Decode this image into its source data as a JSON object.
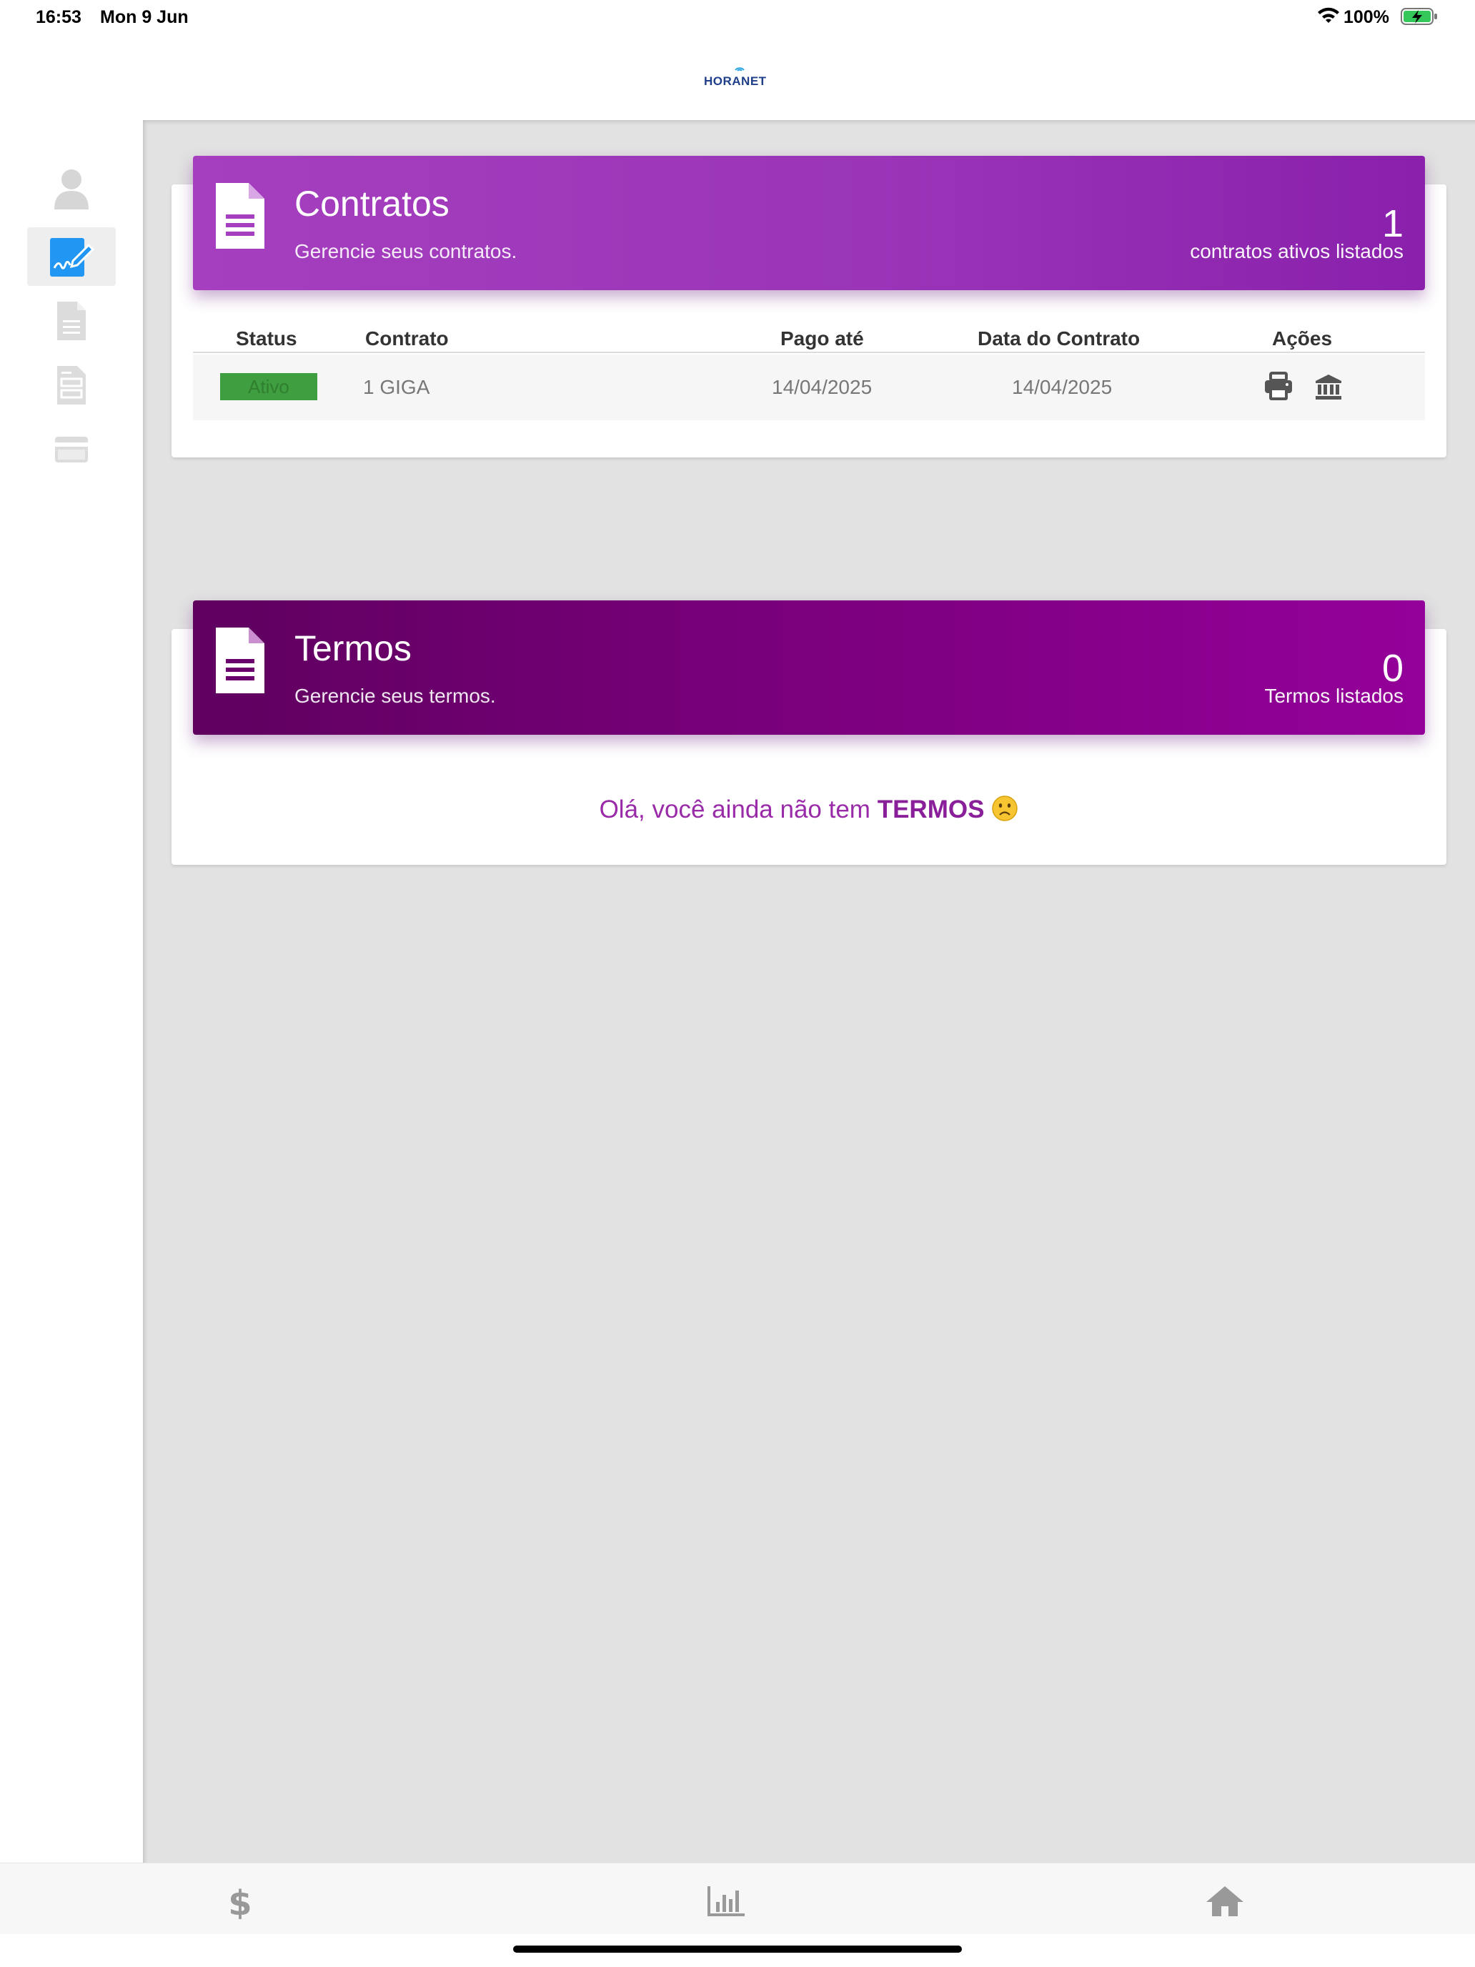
{
  "status_bar": {
    "time": "16:53",
    "date": "Mon 9 Jun",
    "battery": "100%"
  },
  "header": {
    "logo_text": "HORANET"
  },
  "sidebar": {
    "items": [
      {
        "name": "profile",
        "icon": "user-icon"
      },
      {
        "name": "contracts",
        "icon": "signature-icon",
        "active": true
      },
      {
        "name": "documents",
        "icon": "document-icon"
      },
      {
        "name": "invoices",
        "icon": "receipt-icon"
      },
      {
        "name": "payments",
        "icon": "credit-card-icon"
      }
    ]
  },
  "contratos": {
    "title": "Contratos",
    "subtitle": "Gerencie seus contratos.",
    "count": "1",
    "count_label": "contratos ativos listados",
    "color": "#a53fbf",
    "table": {
      "headers": {
        "status": "Status",
        "contrato": "Contrato",
        "pago_ate": "Pago até",
        "data_contrato": "Data do Contrato",
        "acoes": "Ações"
      },
      "rows": [
        {
          "status": "Ativo",
          "status_color": "#3f9e3f",
          "contrato": "1 GIGA",
          "pago_ate": "14/04/2025",
          "data_contrato": "14/04/2025"
        }
      ]
    }
  },
  "termos": {
    "title": "Termos",
    "subtitle": "Gerencie seus termos.",
    "count": "0",
    "count_label": "Termos listados",
    "color": "#78007a",
    "empty_prefix": "Olá, você ainda não tem ",
    "empty_strong": "TERMOS"
  },
  "tabbar": {
    "tabs": [
      {
        "icon": "dollar-icon"
      },
      {
        "icon": "bar-chart-icon"
      },
      {
        "icon": "home-icon"
      }
    ]
  }
}
